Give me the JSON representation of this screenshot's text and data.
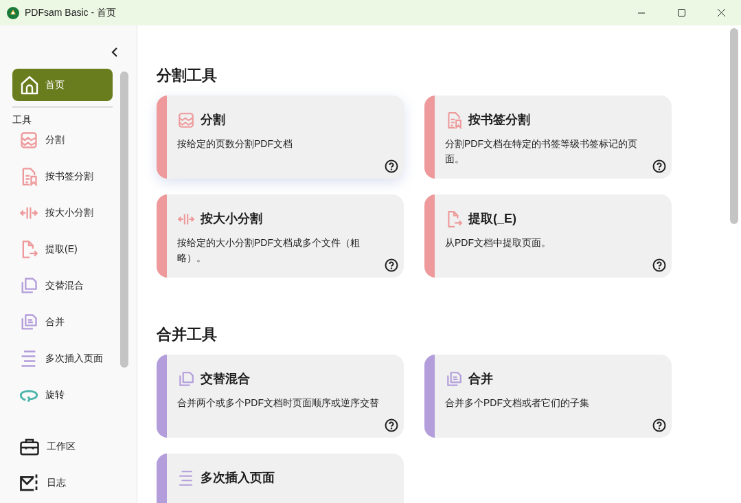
{
  "window": {
    "title": "PDFsam Basic - 首页"
  },
  "sidebar": {
    "home": {
      "label": "首页",
      "selected": true
    },
    "section_label": "工具",
    "tools": [
      {
        "label": "分割",
        "kind": "split",
        "color": "#ee9a9c"
      },
      {
        "label": "按书签分割",
        "kind": "bookmark",
        "color": "#ee9a9c"
      },
      {
        "label": "按大小分割",
        "kind": "size",
        "color": "#ee9a9c"
      },
      {
        "label": "提取(E)",
        "kind": "extract",
        "color": "#ee9a9c"
      },
      {
        "label": "交替混合",
        "kind": "alternate",
        "color": "#b39ddb"
      },
      {
        "label": "合并",
        "kind": "merge",
        "color": "#b39ddb"
      },
      {
        "label": "多次插入页面",
        "kind": "insert",
        "color": "#b39ddb"
      },
      {
        "label": "旋转",
        "kind": "rotate",
        "color": "#4db6ac"
      }
    ],
    "bottom": [
      {
        "label": "工作区",
        "kind": "workspace"
      },
      {
        "label": "日志",
        "kind": "log"
      }
    ]
  },
  "sections": [
    {
      "title": "分割工具",
      "cards": [
        {
          "title": "分割",
          "description": "按给定的页数分割PDF文档",
          "kind": "split",
          "color": "#ee9a9c"
        },
        {
          "title": "按书签分割",
          "description": "分割PDF文档在特定的书签等级书签标记的页面。",
          "kind": "bookmark",
          "color": "#ee9a9c"
        },
        {
          "title": "按大小分割",
          "description": "按给定的大小分割PDF文档成多个文件（粗略）。",
          "kind": "size",
          "color": "#ee9a9c"
        },
        {
          "title": "提取(_E)",
          "description": "从PDF文档中提取页面。",
          "kind": "extract",
          "color": "#ee9a9c"
        }
      ]
    },
    {
      "title": "合并工具",
      "cards": [
        {
          "title": "交替混合",
          "description": "合并两个或多个PDF文档时页面顺序或逆序交替",
          "kind": "alternate",
          "color": "#b39ddb"
        },
        {
          "title": "合并",
          "description": "合并多个PDF文档或者它们的子集",
          "kind": "merge",
          "color": "#b39ddb"
        },
        {
          "title": "多次插入页面",
          "kind": "insert",
          "color": "#b39ddb"
        }
      ]
    }
  ]
}
